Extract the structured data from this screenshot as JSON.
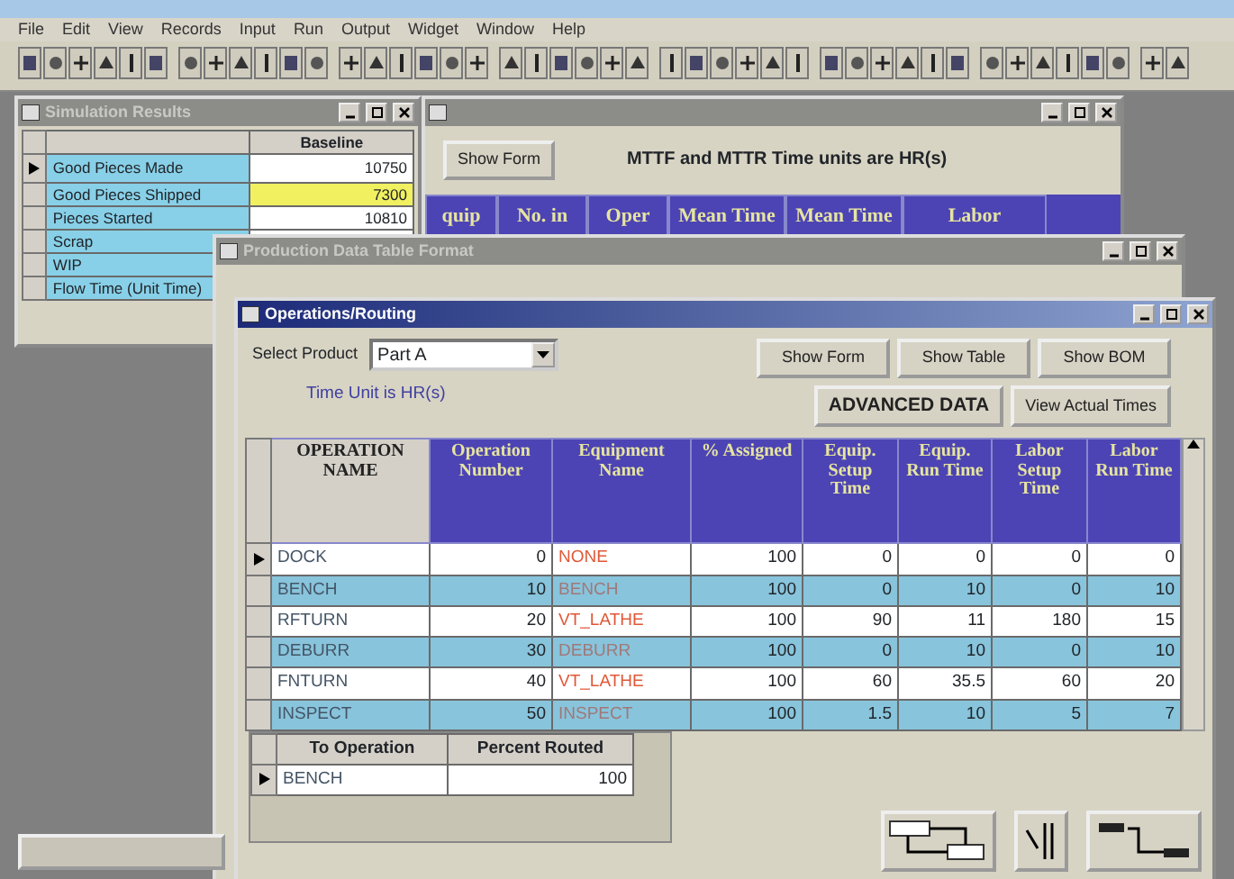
{
  "menu": [
    "File",
    "Edit",
    "View",
    "Records",
    "Input",
    "Run",
    "Output",
    "Widget",
    "Window",
    "Help"
  ],
  "results_window": {
    "title": "Simulation Results",
    "column": "Baseline",
    "rows": [
      {
        "label": "Good Pieces Made",
        "value": "10750",
        "selected": true,
        "highlighted": false
      },
      {
        "label": "Good Pieces Shipped",
        "value": "7300",
        "selected": false,
        "highlighted": true
      },
      {
        "label": "Pieces Started",
        "value": "10810",
        "selected": false,
        "highlighted": false
      },
      {
        "label": "Scrap",
        "selected": false
      },
      {
        "label": "WIP",
        "selected": false
      },
      {
        "label": "Flow Time (Unit Time)",
        "selected": false
      }
    ]
  },
  "equipment_window": {
    "button": "Show Form",
    "note": "MTTF and MTTR Time units are HR(s)",
    "columns": [
      "quip",
      "No. in",
      "Oper",
      "Mean Time",
      "Mean Time",
      "Labor"
    ]
  },
  "table_window": {
    "title": "Production Data Table Format"
  },
  "routing_window": {
    "title": "Operations/Routing",
    "product_label": "Select Product",
    "product": "Part A",
    "time_unit": "Time Unit is HR(s)",
    "buttons": [
      {
        "label": "Show Form",
        "kind": "normal"
      },
      {
        "label": "Show Table",
        "kind": "normal"
      },
      {
        "label": "Show BOM",
        "kind": "normal"
      },
      {
        "label": "ADVANCED DATA",
        "kind": "bold"
      },
      {
        "label": "View Actual Times",
        "kind": "normal"
      }
    ],
    "columns": [
      "OPERATION NAME",
      "Operation Number",
      "Equipment Name",
      "% Assigned",
      "Equip. Setup Time",
      "Equip. Run Time",
      "Labor Setup Time",
      "Labor Run Time"
    ],
    "rows": [
      {
        "selected": true,
        "cells": [
          "DOCK",
          "0",
          "NONE",
          "100",
          "0",
          "0",
          "0",
          "0"
        ]
      },
      {
        "selected": false,
        "cells": [
          "BENCH",
          "10",
          "BENCH",
          "100",
          "0",
          "10",
          "0",
          "10"
        ]
      },
      {
        "selected": false,
        "cells": [
          "RFTURN",
          "20",
          "VT_LATHE",
          "100",
          "90",
          "11",
          "180",
          "15"
        ]
      },
      {
        "selected": false,
        "cells": [
          "DEBURR",
          "30",
          "DEBURR",
          "100",
          "0",
          "10",
          "0",
          "10"
        ]
      },
      {
        "selected": false,
        "cells": [
          "FNTURN",
          "40",
          "VT_LATHE",
          "100",
          "60",
          "35.5",
          "60",
          "20"
        ]
      },
      {
        "selected": false,
        "cells": [
          "INSPECT",
          "50",
          "INSPECT",
          "100",
          "1.5",
          "10",
          "5",
          "7"
        ]
      }
    ],
    "routing_columns": [
      "To Operation",
      "Percent Routed"
    ],
    "routing_rows": [
      {
        "selected": true,
        "cells": [
          "BENCH",
          "100"
        ]
      }
    ]
  }
}
